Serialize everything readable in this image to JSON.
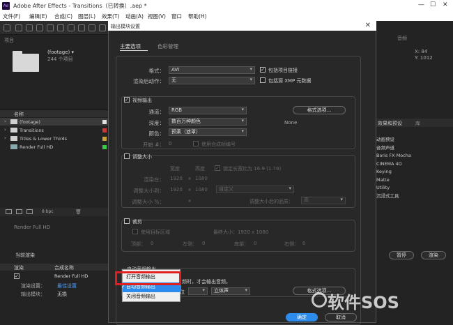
{
  "app": {
    "title": "Adobe After Effects - Transitions（已转换）.aep *",
    "logo_text": "Ae",
    "menus": [
      "文件(F)",
      "编辑(E)",
      "合成(C)",
      "图层(L)",
      "效果(T)",
      "动画(A)",
      "视图(V)",
      "窗口",
      "帮助(H)"
    ]
  },
  "project": {
    "panel_title": "项目",
    "footage_name": "(footage) ▾",
    "footage_count": "244 个项目",
    "column_name": "名称",
    "items": [
      {
        "label": "(footage)",
        "color": "#e0e0e0"
      },
      {
        "label": "Transitions",
        "color": "#c83a3a"
      },
      {
        "label": "Titles & Lower Thirds",
        "color": "#c8a23a"
      },
      {
        "label": "Render Full HD",
        "color": "#3ac84a"
      }
    ],
    "bpc": "8 bpc"
  },
  "timeline": {
    "tab": "Render Full HD",
    "current_render": "当前渲染",
    "col_render": "渲染",
    "col_comp": "合成名称",
    "row_comp": "Render Full HD",
    "render_settings_label": "渲染设置：",
    "render_settings_value": "最佳设置",
    "output_module_label": "输出模块：",
    "output_module_value": "无损"
  },
  "dialog": {
    "title": "输出模块设置",
    "tabs": [
      "主要选项",
      "色彩管理"
    ],
    "format_label": "格式：",
    "format_value": "AVI",
    "post_render_label": "渲染后动作：",
    "post_render_value": "无",
    "include_project_link": "包括项目链接",
    "include_xmp": "包括源 XMP 元数据",
    "video_output": "视频输出",
    "channels_label": "通道：",
    "channels_value": "RGB",
    "depth_label": "深度：",
    "depth_value": "数百万种颜色",
    "color_label": "颜色：",
    "color_value": "预乘（遮罩）",
    "start_label": "开始 #：",
    "start_value": "0",
    "use_comp_frame": "使用合成帧编号",
    "format_options_btn": "格式选项...",
    "none_text": "None",
    "resize": "调整大小",
    "width_header": "宽度",
    "height_header": "高度",
    "lock_aspect": "锁定长宽比为 16:9 (1.78)",
    "render_at_label": "渲染在：",
    "render_at_w": "1920",
    "render_at_x": "x",
    "render_at_h": "1080",
    "resize_to_label": "调整大小到：",
    "resize_to_w": "1920",
    "resize_to_h": "1080",
    "custom_value": "自定义",
    "resize_pct_label": "调整大小 %：",
    "resize_pct_x": "x",
    "quality_label": "调整大小后的品质：",
    "quality_value": "高",
    "crop": "裁剪",
    "use_roi": "使用目标区域",
    "final_size": "最终大小：1920 x 1080",
    "top_label": "顶部：",
    "top_value": "0",
    "left_label": "左侧：",
    "left_value": "0",
    "bottom_label": "底部：",
    "bottom_value": "0",
    "right_label": "右侧：",
    "right_value": "0",
    "audio_auto": "自动音频输出",
    "audio_note": "频时，才会输出音频。",
    "audio_rate_suffix": "位",
    "audio_channels_value": "立体声",
    "audio_format_btn": "格式选项...",
    "ok": "确定",
    "cancel": "取消"
  },
  "popup": {
    "items": [
      "打开音频输出",
      "自动音频输出",
      "关闭音频输出"
    ],
    "checked_index": 1
  },
  "right_panel": {
    "tab_effects": "效果和预设",
    "tab_lib": "库",
    "items": [
      "动画预设",
      "音频声道",
      "Boris FX Mocha",
      "CINEMA 4D",
      "Keying",
      "Matte",
      "Utility",
      "沉浸式工具"
    ],
    "info_tab": "音频",
    "info_x": "X: 84",
    "info_y": "Y: 1012",
    "render_btn": "渲染",
    "queue_btn": "暂停"
  },
  "watermark": {
    "text": "软件SOS"
  }
}
